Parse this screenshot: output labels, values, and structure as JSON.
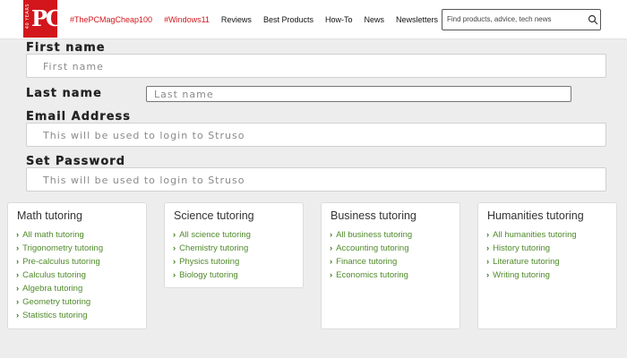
{
  "header": {
    "logo_years": "40 YEARS",
    "logo_text": "PC",
    "nav": [
      {
        "label": "#ThePCMagCheap100",
        "hashtag": true
      },
      {
        "label": "#Windows11",
        "hashtag": true
      },
      {
        "label": "Reviews",
        "hashtag": false
      },
      {
        "label": "Best Products",
        "hashtag": false
      },
      {
        "label": "How-To",
        "hashtag": false
      },
      {
        "label": "News",
        "hashtag": false
      },
      {
        "label": "Newsletters",
        "hashtag": false
      }
    ],
    "search_placeholder": "Find products, advice, tech news",
    "search_icon": "search-icon"
  },
  "form": {
    "first_name": {
      "label": "First name",
      "placeholder": "First name"
    },
    "last_name": {
      "label": "Last name",
      "placeholder": "Last name"
    },
    "email": {
      "label": "Email Address",
      "placeholder": "This will be used to login to Struso"
    },
    "password": {
      "label": "Set Password",
      "placeholder": "This will be used to login to Struso"
    }
  },
  "cards": [
    {
      "title": "Math tutoring",
      "links": [
        "All math tutoring",
        "Trigonometry tutoring",
        "Pre-calculus tutoring",
        "Calculus tutoring",
        "Algebra tutoring",
        "Geometry tutoring",
        "Statistics tutoring"
      ]
    },
    {
      "title": "Science tutoring",
      "links": [
        "All science tutoring",
        "Chemistry tutoring",
        "Physics tutoring",
        "Biology tutoring"
      ]
    },
    {
      "title": "Business tutoring",
      "links": [
        "All business tutoring",
        "Accounting tutoring",
        "Finance tutoring",
        "Economics tutoring"
      ]
    },
    {
      "title": "Humanities tutoring",
      "links": [
        "All humanities tutoring",
        "History tutoring",
        "Literature tutoring",
        "Writing tutoring"
      ]
    }
  ],
  "colors": {
    "brand": "#d2161c",
    "link": "#4f8a2a"
  }
}
